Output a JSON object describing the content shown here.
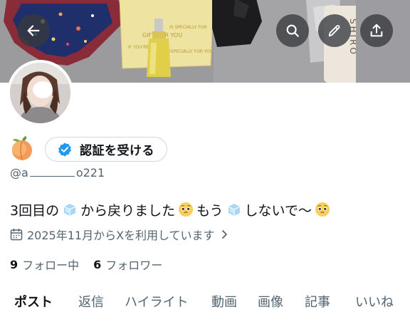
{
  "header": {
    "back_icon": "arrow-left-icon",
    "search_icon": "search-icon",
    "edit_icon": "pencil-icon",
    "share_icon": "share-icon"
  },
  "banner": {
    "package_text_lines": [
      "GIFT FOR YOU",
      "IS SPECIALLY FOR",
      "IF YOU'RE HAPPY",
      "ESPECIALLY FOR YOU"
    ],
    "bottle_brand": "SHIRO"
  },
  "profile": {
    "badge_emoji": "🍑",
    "verify_label": "認証を受ける",
    "handle_prefix": "@a",
    "handle_suffix": "o221",
    "bio_parts": [
      "3回目の",
      "から戻りました",
      "もう",
      "しないで〜"
    ],
    "joined_text": "2025年11月からXを利用しています",
    "following_count": "9",
    "following_label": "フォロー中",
    "followers_count": "6",
    "followers_label": "フォロワー"
  },
  "tabs": [
    "ポスト",
    "返信",
    "ハイライト",
    "動画",
    "画像",
    "記事",
    "いいね"
  ],
  "active_tab": "ポスト",
  "colors": {
    "text_primary": "#0f1419",
    "text_secondary": "#536471",
    "verify_blue": "#1d9bf0",
    "border": "#cfd9de"
  }
}
